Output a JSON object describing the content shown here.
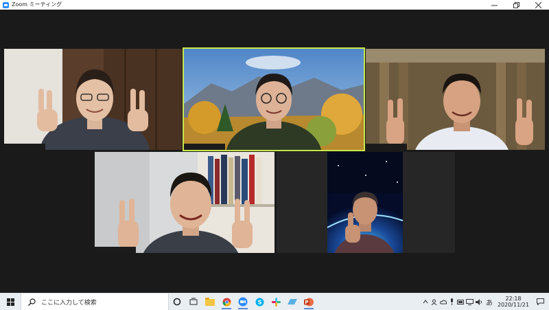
{
  "window": {
    "title": "Zoom ミーティング",
    "controls": [
      "minimize-icon",
      "restore-icon",
      "close-icon"
    ]
  },
  "participants": [
    {
      "position": "top-left",
      "gesture": "peace-sign",
      "background": "wood-panel-room"
    },
    {
      "position": "top-center",
      "gesture": "smiling",
      "background": "autumn-mountain-scenery",
      "active_speaker": true
    },
    {
      "position": "top-right",
      "gesture": "peace-sign",
      "background": "curtained-room"
    },
    {
      "position": "bottom-left",
      "gesture": "peace-sign",
      "background": "bookshelf-room"
    },
    {
      "position": "bottom-right",
      "gesture": "thumbs-up",
      "background": "earth-from-space"
    }
  ],
  "colors": {
    "active_speaker_border": "#c8e84a",
    "meeting_background": "#1a1a1a",
    "taskbar": "#e9eef3",
    "zoom_brand": "#2d8cff"
  },
  "taskbar": {
    "search_placeholder": "ここに入力して検索",
    "pinned": [
      "cortana-icon",
      "task-view-icon",
      "file-explorer-icon",
      "chrome-icon",
      "zoom-icon",
      "skype-icon",
      "slack-icon",
      "photos-icon",
      "powerpoint-icon"
    ],
    "tray": {
      "ime": "あ",
      "time": "22:18",
      "date": "2020/11/21"
    }
  }
}
